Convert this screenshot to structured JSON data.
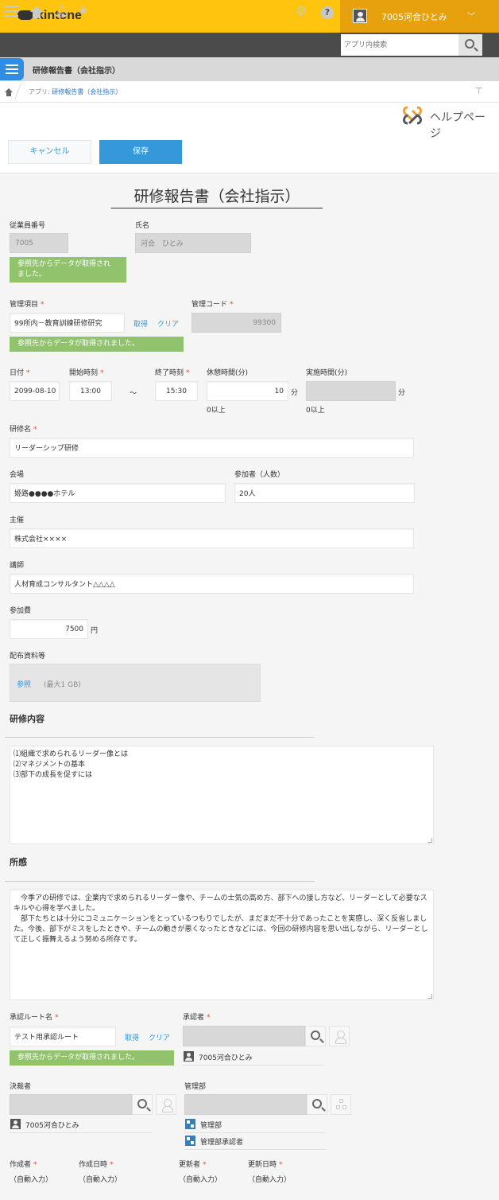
{
  "header": {
    "logo": "kintone",
    "user_name": "7005河合ひとみ",
    "search_placeholder": "アプリ内検索"
  },
  "app": {
    "title": "研修報告書（会社指示）"
  },
  "breadcrumb": {
    "prefix": "アプリ: ",
    "app_link": "研修報告書（会社指示）"
  },
  "help": {
    "label": "ヘルプページ"
  },
  "toolbar": {
    "cancel_label": "キャンセル",
    "save_label": "保存"
  },
  "form": {
    "title": "研修報告書（会社指示）",
    "employee_number": {
      "label": "従業員番号",
      "value": "7005"
    },
    "name": {
      "label": "氏名",
      "value": "河合　ひとみ"
    },
    "lookup_success_wrapped": "参照先からデータが取得され\nました。",
    "lookup_success": "参照先からデータが取得されました。",
    "management_item": {
      "label": "管理項目",
      "value": "99所内－教育訓練研修研究",
      "fetch": "取得",
      "clear": "クリア"
    },
    "management_code": {
      "label": "管理コード",
      "value": "99300"
    },
    "date": {
      "label": "日付",
      "value": "2099-08-10"
    },
    "start_time": {
      "label": "開始時刻",
      "value": "13:00"
    },
    "tilde": "～",
    "end_time": {
      "label": "終了時刻",
      "value": "15:30"
    },
    "break_minutes": {
      "label": "休憩時間(分)",
      "value": "10",
      "unit": "分",
      "hint": "0以上"
    },
    "actual_minutes": {
      "label": "実施時間(分)",
      "value": "",
      "unit": "分",
      "hint": "0以上"
    },
    "training_name": {
      "label": "研修名",
      "value": "リーダーシップ研修"
    },
    "venue": {
      "label": "会場",
      "value": "姫路●●●●ホテル"
    },
    "participants": {
      "label": "参加者（人数）",
      "value": "20人"
    },
    "organizer": {
      "label": "主催",
      "value": "株式会社××××"
    },
    "instructor": {
      "label": "講師",
      "value": "人材育成コンサルタント△△△△"
    },
    "fee": {
      "label": "参加費",
      "value": "7500",
      "unit": "円"
    },
    "materials": {
      "label": "配布資料等",
      "browse": "参照",
      "limit": "(最大1 GB)"
    },
    "content": {
      "label": "研修内容",
      "value": "⑴組織で求められるリーダー像とは\n⑵マネジメントの基本\n⑶部下の成長を促すには"
    },
    "impressions": {
      "label": "所感",
      "value": "　今季アの研修では、企業内で求められるリーダー像や、チームの士気の高め方、部下への接し方など、リーダーとして必要なスキルや心得を学べました。\n　部下たちとは十分にコミュニケーションをとっているつもりでしたが、まだまだ不十分であったことを実感し、深く反省しました。今後、部下がミスをしたときや、チームの動きが悪くなったときなどには、今回の研修内容を思い出しながら、リーダーとして正しく振舞えるよう努める所存です。"
    },
    "approval_route": {
      "label": "承認ルート名",
      "value": "テスト用承認ルート",
      "fetch": "取得",
      "clear": "クリア"
    },
    "approver": {
      "label": "承認者",
      "selected": "7005河合ひとみ"
    },
    "decider": {
      "label": "決裁者",
      "selected": "7005河合ひとみ"
    },
    "department": {
      "label": "管理部",
      "selected": [
        "管理部",
        "管理部承認者"
      ]
    },
    "created_by": {
      "label": "作成者",
      "value": "（自動入力）"
    },
    "created_at": {
      "label": "作成日時",
      "value": "（自動入力）"
    },
    "updated_by": {
      "label": "更新者",
      "value": "（自動入力）"
    },
    "updated_at": {
      "label": "更新日時",
      "value": "（自動入力）"
    }
  }
}
